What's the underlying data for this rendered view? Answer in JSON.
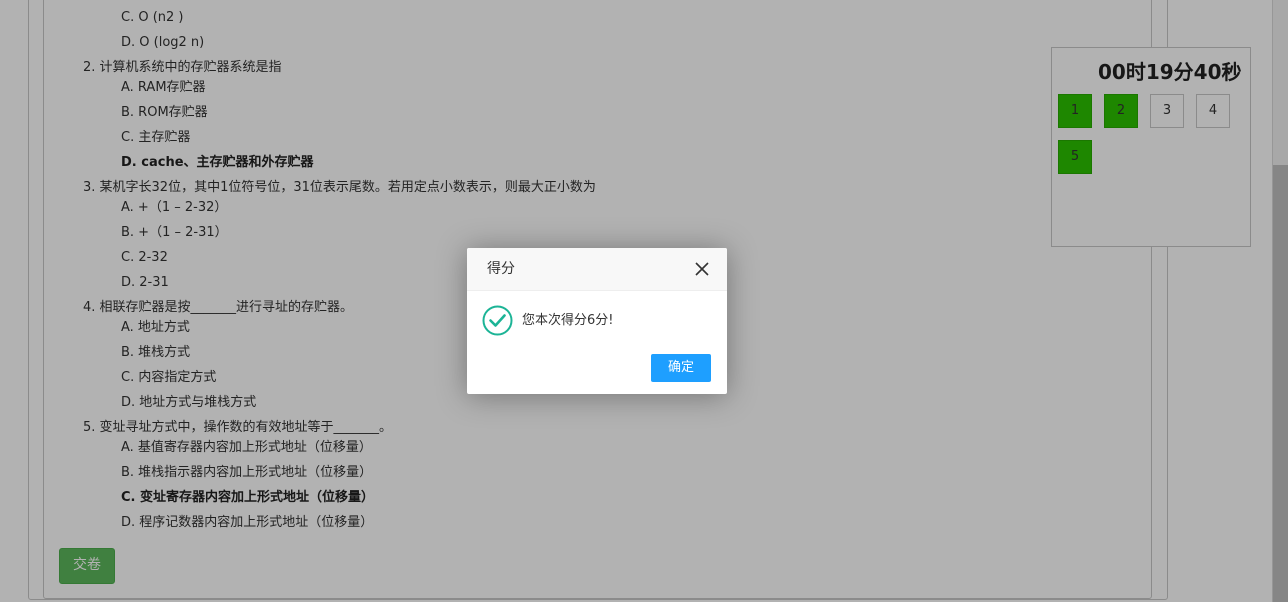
{
  "quiz": {
    "items": [
      {
        "text": "C. O (n2 )"
      },
      {
        "text": "D. O (log2 n)"
      },
      {
        "text": "2. 计算机系统中的存贮器系统是指"
      },
      {
        "text": "A. RAM存贮器"
      },
      {
        "text": "B. ROM存贮器"
      },
      {
        "text": "C. 主存贮器"
      },
      {
        "text": "D. cache、主存贮器和外存贮器"
      },
      {
        "text": "3. 某机字长32位，其中1位符号位，31位表示尾数。若用定点小数表示，则最大正小数为"
      },
      {
        "text": "A. +（1 – 2-32）"
      },
      {
        "text": "B. +（1 – 2-31）"
      },
      {
        "text": "C. 2-32"
      },
      {
        "text": "D. 2-31"
      },
      {
        "text": "4. 相联存贮器是按_______进行寻址的存贮器。"
      },
      {
        "text": "A. 地址方式"
      },
      {
        "text": "B. 堆栈方式"
      },
      {
        "text": "C. 内容指定方式"
      },
      {
        "text": "D. 地址方式与堆栈方式"
      },
      {
        "text": "5. 变址寻址方式中，操作数的有效地址等于_______。"
      },
      {
        "text": "A. 基值寄存器内容加上形式地址（位移量）"
      },
      {
        "text": "B. 堆栈指示器内容加上形式地址（位移量）"
      },
      {
        "text": "C. 变址寄存器内容加上形式地址（位移量）"
      },
      {
        "text": "D. 程序记数器内容加上形式地址（位移量）"
      }
    ],
    "submit_label": "交卷"
  },
  "side": {
    "timer": "00时19分40秒",
    "questions": [
      {
        "num": "1",
        "answered": true
      },
      {
        "num": "2",
        "answered": true
      },
      {
        "num": "3",
        "answered": false
      },
      {
        "num": "4",
        "answered": false
      },
      {
        "num": "5",
        "answered": true
      }
    ]
  },
  "dialog": {
    "title": "得分",
    "message": "您本次得分6分!",
    "ok_label": "确定"
  },
  "colors": {
    "answered": "#2cc200",
    "success": "#1cb496",
    "primary_button": "#1e9fff",
    "submit_button": "#5cb85c"
  },
  "icons": [
    "close-icon",
    "check-circle-icon"
  ]
}
